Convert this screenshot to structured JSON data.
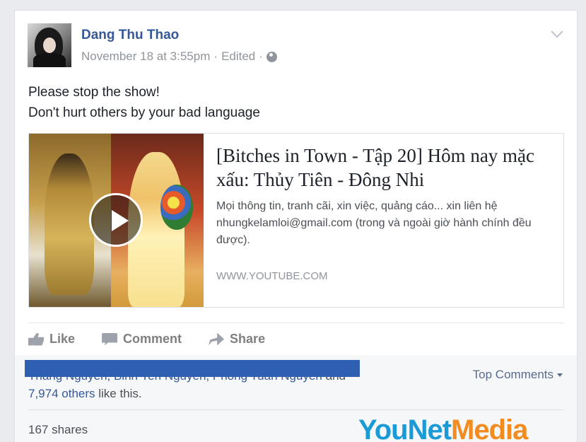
{
  "post": {
    "author": "Dang Thu Thao",
    "date": "November 18 at 3:55pm",
    "separator1": "·",
    "edited": "Edited",
    "separator2": "·",
    "text_line1": "Please stop the show!",
    "text_line2": "Don't hurt others by your bad language"
  },
  "link_preview": {
    "title": "[Bitches in Town - Tập 20] Hôm nay mặc xấu: Thủy Tiên - Đông Nhi",
    "description": "Mọi thông tin, tranh cãi, xin việc, quảng cáo... xin liên hệ nhungkelamloi@gmail.com (trong và ngoài giờ hành chính đều được).",
    "domain": "WWW.YOUTUBE.COM"
  },
  "actions": {
    "like": "Like",
    "comment": "Comment",
    "share": "Share"
  },
  "engagement": {
    "likers_text": "Thang Nguyen, Binh Yen Nguyen, Phong Tuan Nguyen",
    "and_text": "and",
    "others_link": "7,974 others",
    "like_this": "like this.",
    "top_comments": "Top Comments",
    "shares": "167 shares"
  },
  "watermark": {
    "part1": "YouNet",
    "part2": "Media"
  },
  "colors": {
    "link": "#365899",
    "meta": "#90949c",
    "redaction": "#2e5fb0"
  }
}
